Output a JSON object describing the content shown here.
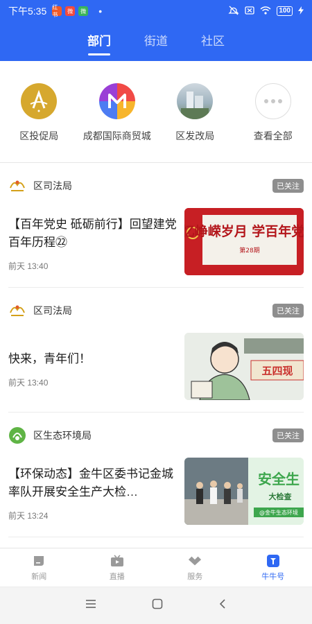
{
  "status": {
    "time": "下午5:35",
    "app_icons": [
      "红书",
      "微",
      "微"
    ],
    "battery": "100"
  },
  "tabs": [
    {
      "label": "部门",
      "active": true
    },
    {
      "label": "街道",
      "active": false
    },
    {
      "label": "社区",
      "active": false
    }
  ],
  "departments": [
    {
      "name": "区投促局",
      "logo": "gold-emblem"
    },
    {
      "name": "成都国际商贸城",
      "logo": "m-logo"
    },
    {
      "name": "区发改局",
      "logo": "building-photo"
    },
    {
      "name": "查看全部",
      "logo": "more-dots-icon"
    }
  ],
  "cards": [
    {
      "source": "区司法局",
      "follow_label": "已关注",
      "title": "【百年党史 砥砺前行】回望建党百年历程㉒",
      "time": "前天 13:40",
      "thumb_text": "忆峥嵘岁月 学百年党史",
      "thumb_sub": "第28期"
    },
    {
      "source": "区司法局",
      "follow_label": "已关注",
      "title": "快来，青年们！",
      "time": "前天 13:40",
      "thumb_text": "五四现"
    },
    {
      "source": "区生态环境局",
      "follow_label": "已关注",
      "title": "【环保动态】金牛区委书记金城率队开展安全生产大检…",
      "time": "前天 13:24",
      "thumb_text": "安全生",
      "thumb_sub": "大检查",
      "thumb_tag": "@金牛生态环境"
    }
  ],
  "bottom_nav": [
    {
      "label": "新闻",
      "icon": "news-icon",
      "active": false
    },
    {
      "label": "直播",
      "icon": "tv-icon",
      "active": false
    },
    {
      "label": "服务",
      "icon": "service-icon",
      "active": false
    },
    {
      "label": "牛牛号",
      "icon": "niuniu-icon",
      "active": true
    }
  ],
  "colors": {
    "brand": "#2f68f3",
    "follow_badge": "#8e8e8e"
  }
}
